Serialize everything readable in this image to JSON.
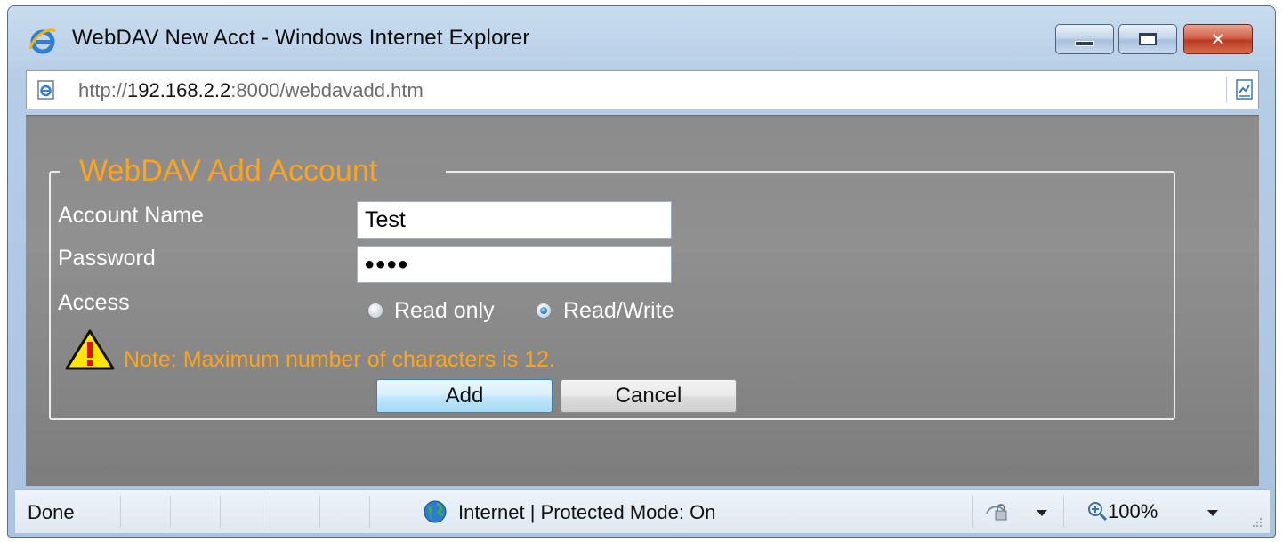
{
  "window": {
    "title": "WebDAV New Acct - Windows Internet Explorer",
    "controls": {
      "minimize": "minimize",
      "maximize": "maximize",
      "close": "close"
    }
  },
  "address": {
    "scheme": "http://",
    "host": "192.168.2.2",
    "rest": ":8000/webdavadd.htm"
  },
  "form": {
    "legend": "WebDAV Add Account",
    "account_name_label": "Account Name",
    "account_name_value": "Test",
    "password_label": "Password",
    "password_value": "••••",
    "access_label": "Access",
    "access_options": [
      "Read only",
      "Read/Write"
    ],
    "access_selected": "Read/Write",
    "note": "Note: Maximum number of characters is 12.",
    "add_label": "Add",
    "cancel_label": "Cancel"
  },
  "statusbar": {
    "status": "Done",
    "zone": "Internet | Protected Mode: On",
    "zoom": "100%"
  },
  "colors": {
    "accent_orange": "#ffa31a",
    "content_gray": "#8c8c8c",
    "frame_blue": "#b6cde6"
  },
  "icons": [
    "ie-logo-icon",
    "page-icon",
    "compatibility-view-icon",
    "warning-icon",
    "globe-icon",
    "security-icon",
    "zoom-icon",
    "resize-grip-icon"
  ]
}
